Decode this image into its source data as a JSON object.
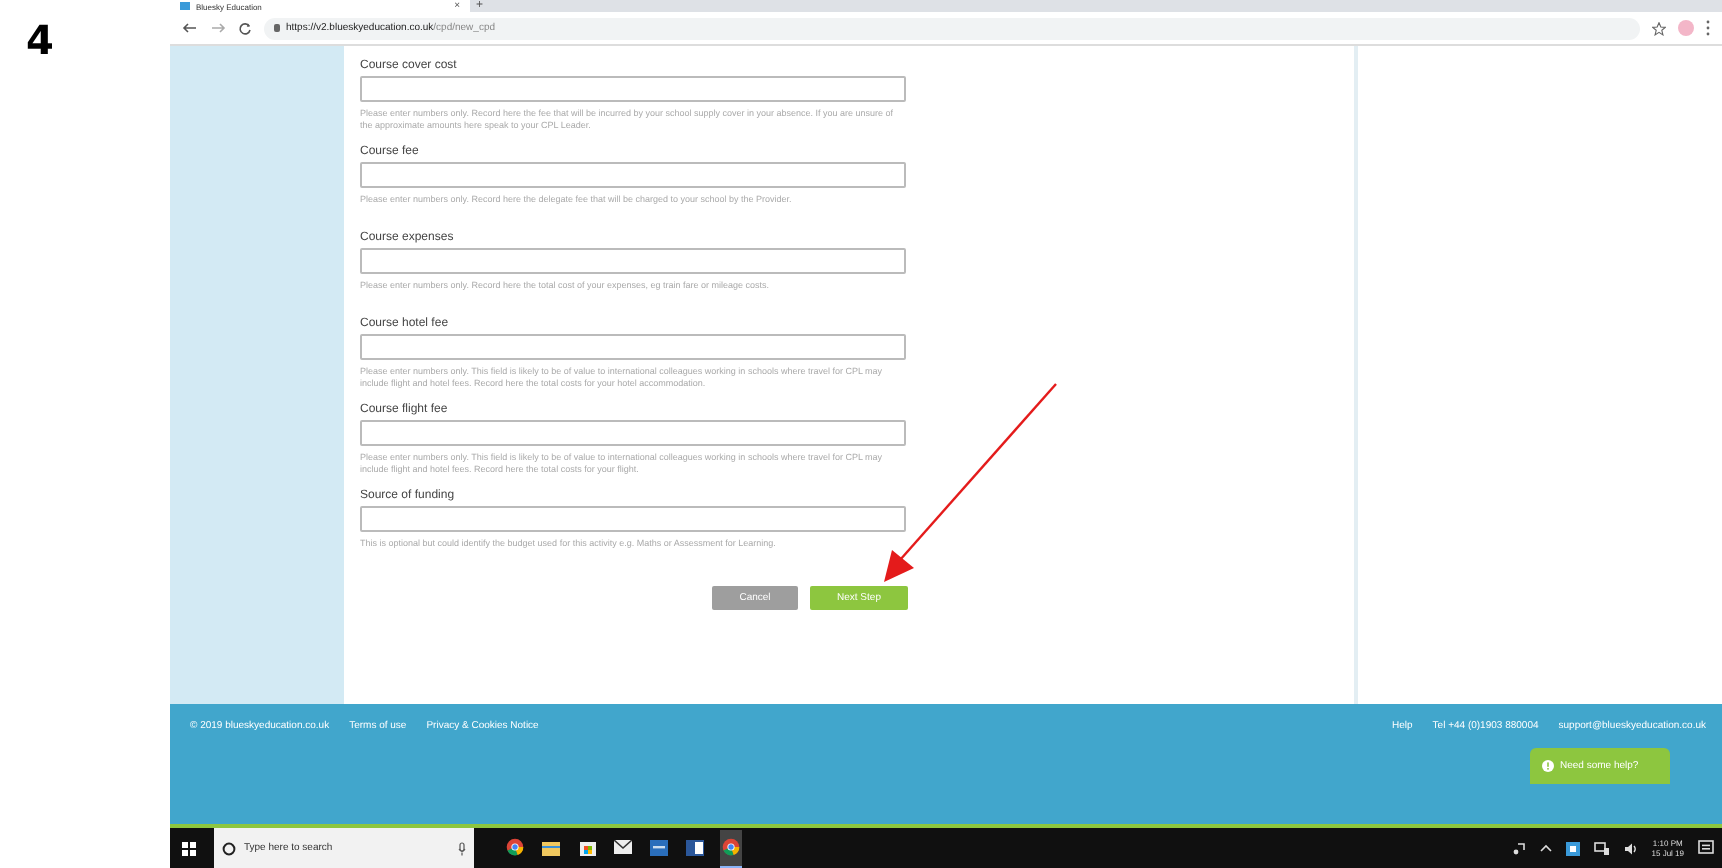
{
  "step_number": "4",
  "browser": {
    "tab_title": "Bluesky Education",
    "close_tab": "×",
    "new_tab": "+",
    "url_host": "https://v2.blueskyeducation.co.uk",
    "url_path": "/cpd/new_cpd"
  },
  "form": {
    "fields": [
      {
        "label": "Course cover cost",
        "help": "Please enter numbers only. Record here the fee that will be incurred by your school supply cover in your absence. If you are unsure of the approximate amounts here speak to your CPL Leader."
      },
      {
        "label": "Course fee",
        "help": "Please enter numbers only. Record here the delegate fee that will be charged to your school by the Provider."
      },
      {
        "label": "Course expenses",
        "help": "Please enter numbers only. Record here the total cost of your expenses, eg train fare or mileage costs."
      },
      {
        "label": "Course hotel fee",
        "help": "Please enter numbers only. This field is likely to be of value to international colleagues working in schools where travel for CPL may include flight and hotel fees. Record here the total costs for your hotel accommodation."
      },
      {
        "label": "Course flight fee",
        "help": "Please enter numbers only. This field is likely to be of value to international colleagues working in schools where travel for CPL may include flight and hotel fees. Record here the total costs for your flight."
      },
      {
        "label": "Source of funding",
        "help": "This is optional but could identify the budget used for this activity e.g. Maths or Assessment for Learning."
      }
    ],
    "buttons": [
      {
        "label": "Cancel",
        "kind": "secondary"
      },
      {
        "label": "Next Step",
        "kind": "primary"
      }
    ]
  },
  "footer": {
    "left": [
      "© 2019 blueskyeducation.co.uk",
      "Terms of use",
      "Privacy & Cookies Notice"
    ],
    "right": [
      "Help",
      "Tel +44 (0)1903 880004",
      "support@blueskyeducation.co.uk"
    ]
  },
  "help_button": "Need some help?",
  "taskbar": {
    "search_placeholder": "Type here to search",
    "apps": [
      {
        "kind": "chrome",
        "selected": false
      },
      {
        "kind": "folder",
        "selected": false
      },
      {
        "kind": "store",
        "selected": false
      },
      {
        "kind": "mail",
        "selected": false
      },
      {
        "kind": "app",
        "selected": false
      },
      {
        "kind": "word",
        "selected": false
      },
      {
        "kind": "chrome",
        "selected": true
      }
    ],
    "time": "1:10 PM",
    "date": "15 Jul 19"
  }
}
